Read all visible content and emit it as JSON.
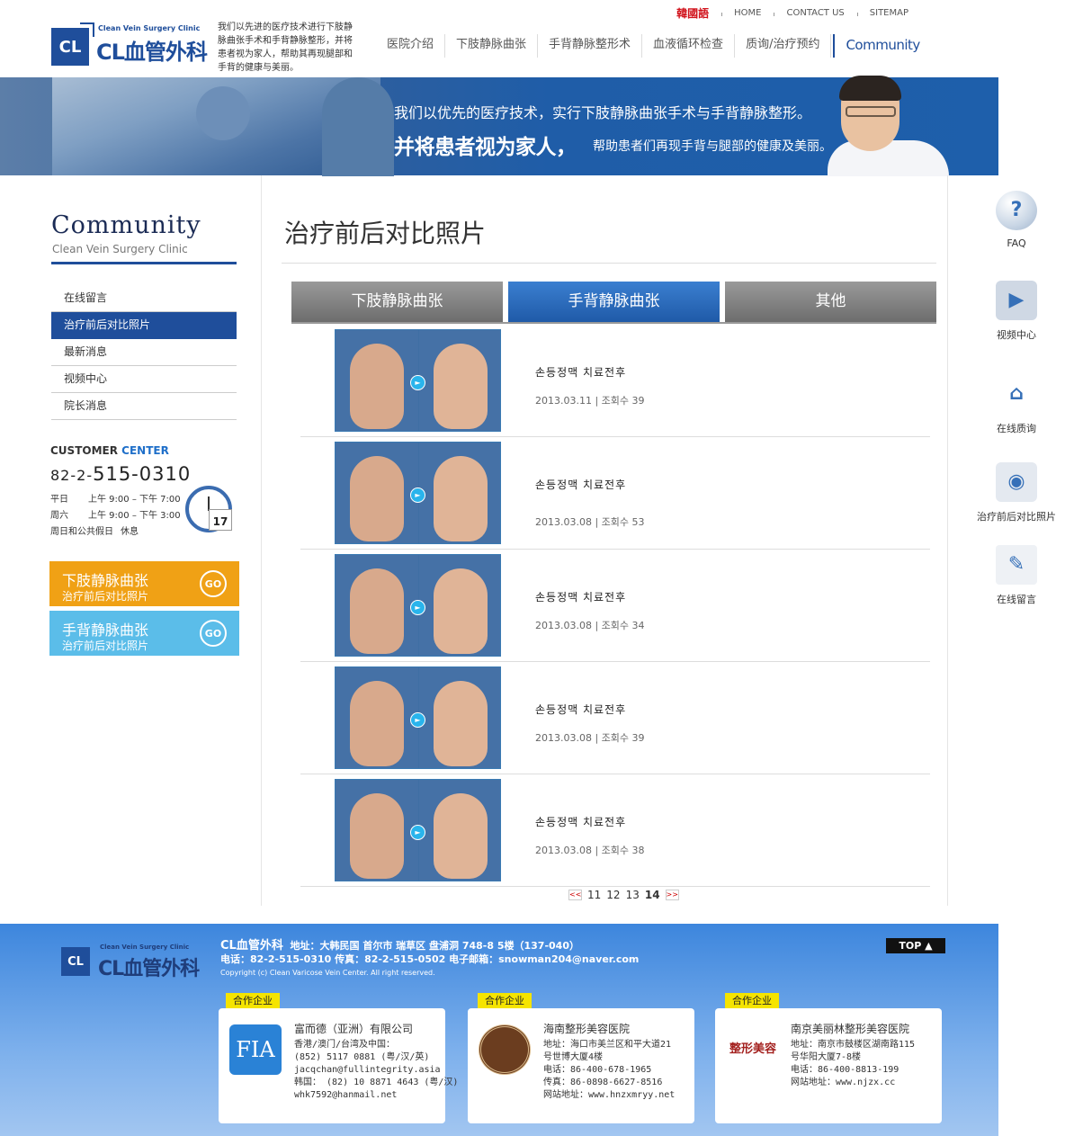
{
  "header": {
    "logo_sub": "Clean Vein Surgery Clinic",
    "logo_name": "CL血管外科",
    "logo_box": "CL",
    "tagline": "我们以先进的医疗技术进行下肢静脉曲张手术和手背静脉整形，并将患者视为家人，帮助其再现腿部和手背的健康与美丽。",
    "top_links": [
      "韓國語",
      "HOME",
      "CONTACT US",
      "SITEMAP"
    ],
    "main_nav": [
      "医院介绍",
      "下肢静脉曲张",
      "手背静脉整形术",
      "血液循环检查",
      "质询/治疗预约",
      "Community"
    ]
  },
  "banner": {
    "line1": "我们以优先的医疗技术，实行下肢静脉曲张手术与手背静脉整形。",
    "line2": "并将患者视为家人，",
    "line3": "帮助患者们再现手背与腿部的健康及美丽。"
  },
  "sidebar": {
    "title": "Community",
    "subtitle": "Clean Vein Surgery Clinic",
    "menu": [
      "在线留言",
      "治疗前后对比照片",
      "最新消息",
      "视频中心",
      "院长消息"
    ],
    "customer_label": "CUSTOMER",
    "center_label": "CENTER",
    "phone_prefix": "82-2-",
    "phone_main": "515-0310",
    "hours": [
      {
        "day": "平日",
        "time": "上午 9:00 – 下午 7:00"
      },
      {
        "day": "周六",
        "time": "上午 9:00 – 下午 3:00"
      },
      {
        "day": "周日和公共假日",
        "time": "休息"
      }
    ],
    "cal_day": "17",
    "cta1": {
      "title": "下肢静脉曲张",
      "sub": "治疗前后对比照片",
      "go": "GO",
      "color": "#f0a115"
    },
    "cta2": {
      "title": "手背静脉曲张",
      "sub": "治疗前后对比照片",
      "go": "GO",
      "color": "#5bbde9"
    }
  },
  "main": {
    "title": "治疗前后对比照片",
    "tabs": [
      "下肢静脉曲张",
      "手背静脉曲张",
      "其他"
    ],
    "items": [
      {
        "title": "손등정맥 치료전후",
        "meta": "2013.03.11 | 조회수 39"
      },
      {
        "title": "손등정맥 치료전후",
        "meta": "2013.03.08 | 조회수 53"
      },
      {
        "title": "손등정맥 치료전후",
        "meta": "2013.03.08 | 조회수 34"
      },
      {
        "title": "손등정맥 치료전후",
        "meta": "2013.03.08 | 조회수 39"
      },
      {
        "title": "손등정맥 치료전후",
        "meta": "2013.03.08 | 조회수 38"
      }
    ],
    "pager": {
      "prev": "<<",
      "pages": [
        "11",
        "12",
        "13",
        "14"
      ],
      "current": "14",
      "next": ">>"
    }
  },
  "quick": [
    "FAQ",
    "视频中心",
    "在线质询",
    "治疗前后对比照片",
    "在线留言"
  ],
  "footer": {
    "name": "CL血管外科",
    "address": "地址：大韩民国 首尔市 瑞草区 盘浦洞 748-8 5楼（137-040）",
    "contact": "电话：82-2-515-0310  传真：82-2-515-0502  电子邮箱：snowman204@naver.com",
    "copyright": "Copyright (c) Clean Varicose Vein Center. All right reserved.",
    "top": "TOP ▲",
    "partner_tag": "合作企业",
    "partners": [
      {
        "logo": "FIA",
        "name": "富而德（亚洲）有限公司",
        "lines": [
          "香港/澳门/台湾及中国：",
          "(852) 5117 0881 (粤/汉/英)",
          "jacqchan@fullintegrity.asia",
          "韩国： (82) 10 8871 4643 (粤/汉)",
          "whk7592@hanmail.net"
        ]
      },
      {
        "logo": "",
        "name": "海南整形美容医院",
        "lines": [
          "地址：海口市美兰区和平大道21",
          "      号世博大厦4楼",
          "电话：86-400-678-1965",
          "传真：86-0898-6627-8516",
          "网站地址：www.hnzxmryy.net"
        ]
      },
      {
        "logo": "整形美容",
        "name": "南京美丽林整形美容医院",
        "lines": [
          "地址：南京市鼓楼区湖南路115",
          "      号华阳大厦7-8楼",
          "电话：86-400-8813-199",
          "网站地址：www.njzx.cc"
        ]
      }
    ]
  }
}
